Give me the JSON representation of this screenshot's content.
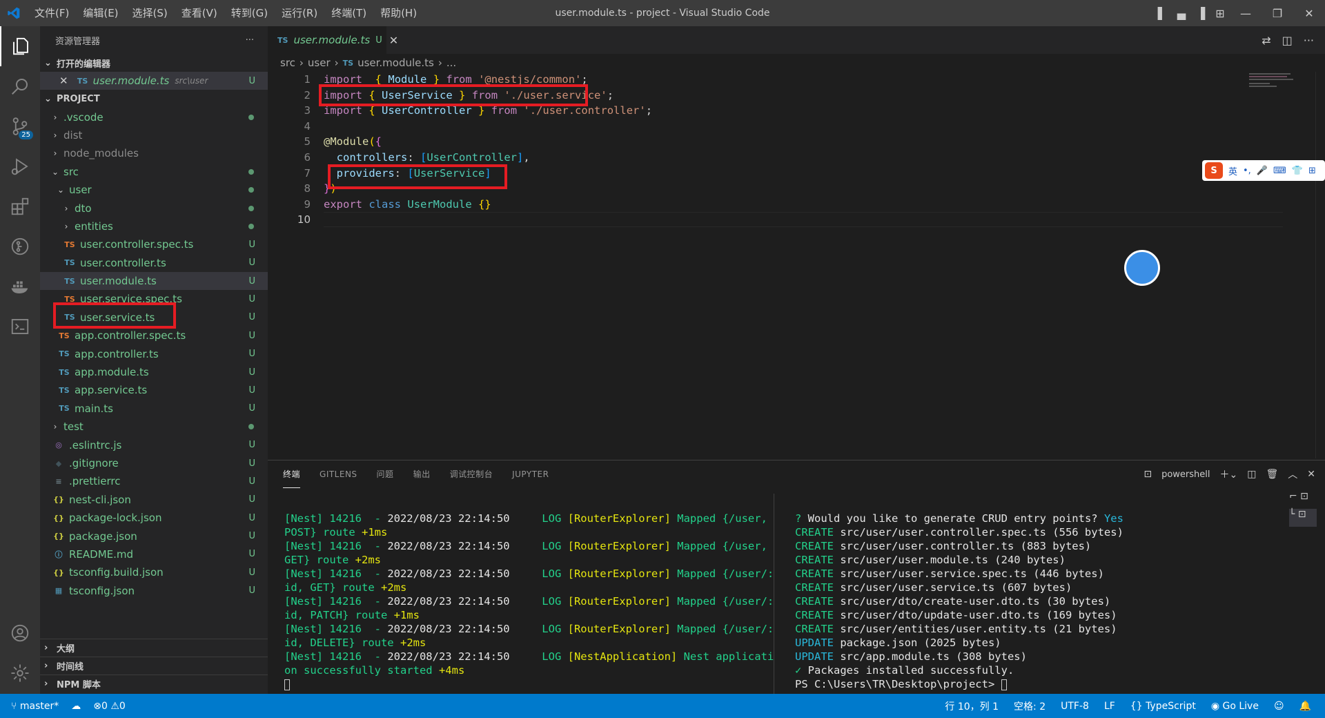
{
  "titlebar": {
    "menu": [
      "文件(F)",
      "编辑(E)",
      "选择(S)",
      "查看(V)",
      "转到(G)",
      "运行(R)",
      "终端(T)",
      "帮助(H)"
    ],
    "window_title": "user.module.ts - project - Visual Studio Code"
  },
  "activitybar": {
    "scm_badge": "25"
  },
  "sidebar": {
    "header": "资源管理器",
    "open_editors_title": "打开的编辑器",
    "open_editor": {
      "name": "user.module.ts",
      "path": "src\\user",
      "status": "U",
      "icon": "TS"
    },
    "project_title": "PROJECT",
    "tree": [
      {
        "label": ".vscode",
        "type": "folder",
        "depth": 0,
        "status": "dot"
      },
      {
        "label": "dist",
        "type": "folder",
        "depth": 0,
        "status": ""
      },
      {
        "label": "node_modules",
        "type": "folder",
        "depth": 0,
        "status": ""
      },
      {
        "label": "src",
        "type": "folder-open",
        "depth": 0,
        "status": "dot"
      },
      {
        "label": "user",
        "type": "folder-open",
        "depth": 1,
        "status": "dot"
      },
      {
        "label": "dto",
        "type": "folder",
        "depth": 2,
        "status": "dot"
      },
      {
        "label": "entities",
        "type": "folder",
        "depth": 2,
        "status": "dot"
      },
      {
        "label": "user.controller.spec.ts",
        "type": "tsspec",
        "depth": 2,
        "status": "U"
      },
      {
        "label": "user.controller.ts",
        "type": "ts",
        "depth": 2,
        "status": "U"
      },
      {
        "label": "user.module.ts",
        "type": "ts",
        "depth": 2,
        "status": "U",
        "selected": true
      },
      {
        "label": "user.service.spec.ts",
        "type": "tsspec",
        "depth": 2,
        "status": "U"
      },
      {
        "label": "user.service.ts",
        "type": "ts",
        "depth": 2,
        "status": "U"
      },
      {
        "label": "app.controller.spec.ts",
        "type": "tsspec",
        "depth": 1,
        "status": "U"
      },
      {
        "label": "app.controller.ts",
        "type": "ts",
        "depth": 1,
        "status": "U"
      },
      {
        "label": "app.module.ts",
        "type": "ts",
        "depth": 1,
        "status": "U"
      },
      {
        "label": "app.service.ts",
        "type": "ts",
        "depth": 1,
        "status": "U"
      },
      {
        "label": "main.ts",
        "type": "ts",
        "depth": 1,
        "status": "U"
      },
      {
        "label": "test",
        "type": "folder",
        "depth": 0,
        "status": "dot"
      },
      {
        "label": ".eslintrc.js",
        "type": "eslint",
        "depth": 0,
        "status": "U"
      },
      {
        "label": ".gitignore",
        "type": "git",
        "depth": 0,
        "status": "U"
      },
      {
        "label": ".prettierrc",
        "type": "settings",
        "depth": 0,
        "status": "U"
      },
      {
        "label": "nest-cli.json",
        "type": "json",
        "depth": 0,
        "status": "U"
      },
      {
        "label": "package-lock.json",
        "type": "json",
        "depth": 0,
        "status": "U"
      },
      {
        "label": "package.json",
        "type": "json",
        "depth": 0,
        "status": "U"
      },
      {
        "label": "README.md",
        "type": "info",
        "depth": 0,
        "status": "U"
      },
      {
        "label": "tsconfig.build.json",
        "type": "json",
        "depth": 0,
        "status": "U"
      },
      {
        "label": "tsconfig.json",
        "type": "tsconfig",
        "depth": 0,
        "status": "U"
      }
    ],
    "outline_title": "大纲",
    "timeline_title": "时间线",
    "npm_title": "NPM 脚本"
  },
  "editor": {
    "tab": {
      "name": "user.module.ts",
      "status": "U",
      "icon": "TS"
    },
    "breadcrumb": [
      "src",
      "user",
      "user.module.ts",
      "..."
    ],
    "line_numbers": [
      "1",
      "2",
      "3",
      "4",
      "5",
      "6",
      "7",
      "8",
      "9",
      "10"
    ],
    "lines": [
      [
        [
          "kw",
          "import"
        ],
        [
          "",
          "  "
        ],
        [
          "br1",
          "{"
        ],
        [
          "",
          " "
        ],
        [
          "id",
          "Module"
        ],
        [
          "",
          " "
        ],
        [
          "br1",
          "}"
        ],
        [
          "",
          " "
        ],
        [
          "kw",
          "from"
        ],
        [
          "",
          " "
        ],
        [
          "str",
          "'@nestjs/common'"
        ],
        [
          "",
          ";"
        ]
      ],
      [
        [
          "kw",
          "import"
        ],
        [
          "",
          " "
        ],
        [
          "br1",
          "{"
        ],
        [
          "",
          " "
        ],
        [
          "id",
          "UserService"
        ],
        [
          "",
          " "
        ],
        [
          "br1",
          "}"
        ],
        [
          "",
          " "
        ],
        [
          "kw",
          "from"
        ],
        [
          "",
          " "
        ],
        [
          "str",
          "'./user.service'"
        ],
        [
          "",
          ";"
        ]
      ],
      [
        [
          "kw",
          "import"
        ],
        [
          "",
          " "
        ],
        [
          "br1",
          "{"
        ],
        [
          "",
          " "
        ],
        [
          "id",
          "UserController"
        ],
        [
          "",
          " "
        ],
        [
          "br1",
          "}"
        ],
        [
          "",
          " "
        ],
        [
          "kw",
          "from"
        ],
        [
          "",
          " "
        ],
        [
          "str",
          "'./user.controller'"
        ],
        [
          "",
          ";"
        ]
      ],
      [],
      [
        [
          "fn",
          "@Module"
        ],
        [
          "br1",
          "("
        ],
        [
          "br2",
          "{"
        ]
      ],
      [
        [
          "",
          "  "
        ],
        [
          "id",
          "controllers"
        ],
        [
          "",
          ": "
        ],
        [
          "br3",
          "["
        ],
        [
          "cls",
          "UserController"
        ],
        [
          "br3",
          "]"
        ],
        [
          "",
          ","
        ]
      ],
      [
        [
          "",
          "  "
        ],
        [
          "id",
          "providers"
        ],
        [
          "",
          ": "
        ],
        [
          "br3",
          "["
        ],
        [
          "cls",
          "UserService"
        ],
        [
          "br3",
          "]"
        ]
      ],
      [
        [
          "br2",
          "}"
        ],
        [
          "br1",
          ")"
        ]
      ],
      [
        [
          "kw",
          "export"
        ],
        [
          "",
          " "
        ],
        [
          "kb",
          "class"
        ],
        [
          "",
          " "
        ],
        [
          "cls",
          "UserModule"
        ],
        [
          "",
          " "
        ],
        [
          "br1",
          "{}"
        ]
      ],
      []
    ]
  },
  "panel": {
    "tabs": [
      "终端",
      "GITLENS",
      "问题",
      "输出",
      "调试控制台",
      "JUPYTER"
    ],
    "shell": "powershell",
    "left_log": [
      [
        [
          "tg",
          "[Nest] 14216  - "
        ],
        [
          "tw",
          "2022/08/23 22:14:50     "
        ],
        [
          "tg",
          "LOG "
        ],
        [
          "ty",
          "[RouterExplorer] "
        ],
        [
          "tg",
          "Mapped {/user,"
        ]
      ],
      [
        [
          "tg",
          "POST} route "
        ],
        [
          "ty",
          "+1ms"
        ]
      ],
      [
        [
          "tg",
          "[Nest] 14216  - "
        ],
        [
          "tw",
          "2022/08/23 22:14:50     "
        ],
        [
          "tg",
          "LOG "
        ],
        [
          "ty",
          "[RouterExplorer] "
        ],
        [
          "tg",
          "Mapped {/user,"
        ]
      ],
      [
        [
          "tg",
          "GET} route "
        ],
        [
          "ty",
          "+2ms"
        ]
      ],
      [
        [
          "tg",
          "[Nest] 14216  - "
        ],
        [
          "tw",
          "2022/08/23 22:14:50     "
        ],
        [
          "tg",
          "LOG "
        ],
        [
          "ty",
          "[RouterExplorer] "
        ],
        [
          "tg",
          "Mapped {/user/:"
        ]
      ],
      [
        [
          "tg",
          "id, GET} route "
        ],
        [
          "ty",
          "+2ms"
        ]
      ],
      [
        [
          "tg",
          "[Nest] 14216  - "
        ],
        [
          "tw",
          "2022/08/23 22:14:50     "
        ],
        [
          "tg",
          "LOG "
        ],
        [
          "ty",
          "[RouterExplorer] "
        ],
        [
          "tg",
          "Mapped {/user/:"
        ]
      ],
      [
        [
          "tg",
          "id, PATCH} route "
        ],
        [
          "ty",
          "+1ms"
        ]
      ],
      [
        [
          "tg",
          "[Nest] 14216  - "
        ],
        [
          "tw",
          "2022/08/23 22:14:50     "
        ],
        [
          "tg",
          "LOG "
        ],
        [
          "ty",
          "[RouterExplorer] "
        ],
        [
          "tg",
          "Mapped {/user/:"
        ]
      ],
      [
        [
          "tg",
          "id, DELETE} route "
        ],
        [
          "ty",
          "+2ms"
        ]
      ],
      [
        [
          "tg",
          "[Nest] 14216  - "
        ],
        [
          "tw",
          "2022/08/23 22:14:50     "
        ],
        [
          "tg",
          "LOG "
        ],
        [
          "ty",
          "[NestApplication] "
        ],
        [
          "tg",
          "Nest applicati"
        ]
      ],
      [
        [
          "tg",
          "on successfully started "
        ],
        [
          "ty",
          "+4ms"
        ]
      ]
    ],
    "right_log": [
      [
        [
          "tg",
          "? "
        ],
        [
          "tw",
          "Would you like to generate CRUD entry points? "
        ],
        [
          "tc",
          "Yes"
        ]
      ],
      [
        [
          "tg",
          "CREATE "
        ],
        [
          "tw",
          "src/user/user.controller.spec.ts (556 bytes)"
        ]
      ],
      [
        [
          "tg",
          "CREATE "
        ],
        [
          "tw",
          "src/user/user.controller.ts (883 bytes)"
        ]
      ],
      [
        [
          "tg",
          "CREATE "
        ],
        [
          "tw",
          "src/user/user.module.ts (240 bytes)"
        ]
      ],
      [
        [
          "tg",
          "CREATE "
        ],
        [
          "tw",
          "src/user/user.service.spec.ts (446 bytes)"
        ]
      ],
      [
        [
          "tg",
          "CREATE "
        ],
        [
          "tw",
          "src/user/user.service.ts (607 bytes)"
        ]
      ],
      [
        [
          "tg",
          "CREATE "
        ],
        [
          "tw",
          "src/user/dto/create-user.dto.ts (30 bytes)"
        ]
      ],
      [
        [
          "tg",
          "CREATE "
        ],
        [
          "tw",
          "src/user/dto/update-user.dto.ts (169 bytes)"
        ]
      ],
      [
        [
          "tg",
          "CREATE "
        ],
        [
          "tw",
          "src/user/entities/user.entity.ts (21 bytes)"
        ]
      ],
      [
        [
          "tc",
          "UPDATE "
        ],
        [
          "tw",
          "package.json (2025 bytes)"
        ]
      ],
      [
        [
          "tc",
          "UPDATE "
        ],
        [
          "tw",
          "src/app.module.ts (308 bytes)"
        ]
      ],
      [
        [
          "tg",
          "✓ "
        ],
        [
          "tw",
          "Packages installed successfully."
        ]
      ],
      [
        [
          "tw",
          "PS C:\\Users\\TR\\Desktop\\project> "
        ]
      ]
    ]
  },
  "statusbar": {
    "branch": "master*",
    "errors": "0",
    "warnings": "0",
    "position": "行 10，列 1",
    "spaces": "空格: 2",
    "encoding": "UTF-8",
    "eol": "LF",
    "language": "TypeScript",
    "golive": "Go Live"
  },
  "colors": {
    "accent": "#007acc",
    "highlight_box": "#e51c23",
    "untracked": "#73c991"
  }
}
